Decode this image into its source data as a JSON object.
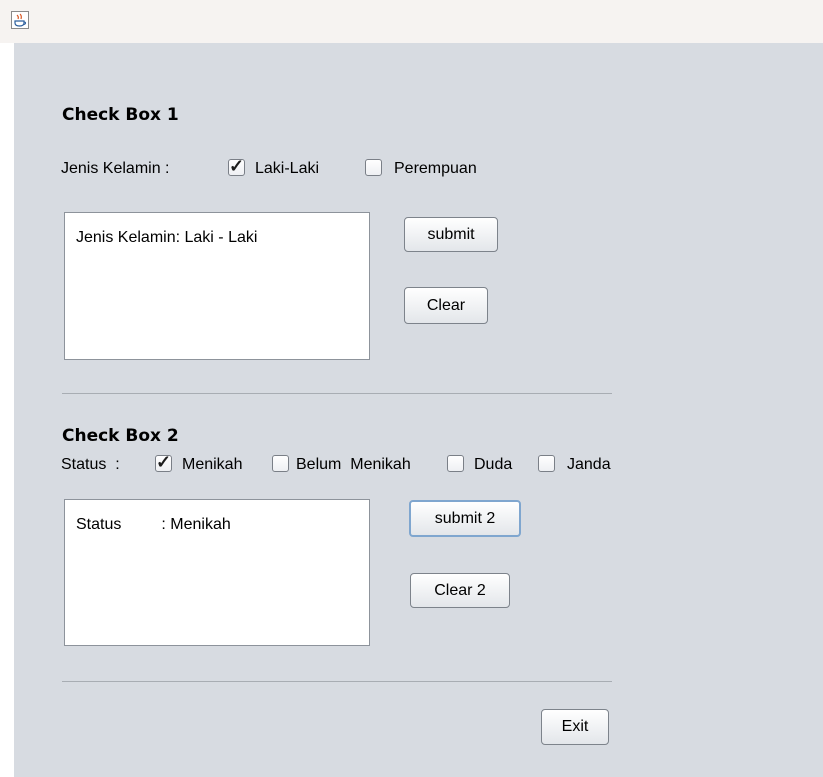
{
  "window": {
    "icon": "java-cup-icon"
  },
  "section1": {
    "title": "Check Box 1",
    "field_label": "Jenis Kelamin :",
    "options": [
      {
        "label": "Laki-Laki",
        "checked": true
      },
      {
        "label": "Perempuan",
        "checked": false
      }
    ],
    "output_text": "Jenis Kelamin: Laki - Laki",
    "submit_label": "submit",
    "clear_label": "Clear"
  },
  "section2": {
    "title": "Check Box 2",
    "field_label": "Status  :",
    "options": [
      {
        "label": "Menikah",
        "checked": true
      },
      {
        "label": "Belum  Menikah",
        "checked": false
      },
      {
        "label": "Duda",
        "checked": false
      },
      {
        "label": "Janda",
        "checked": false
      }
    ],
    "output_text": "Status         : Menikah",
    "submit_label": "submit 2",
    "clear_label": "Clear 2"
  },
  "footer": {
    "exit_label": "Exit"
  },
  "colors": {
    "panel": "#d7dbe1",
    "titlebar": "#f6f3f1",
    "focus_border": "#7fa6cf"
  }
}
